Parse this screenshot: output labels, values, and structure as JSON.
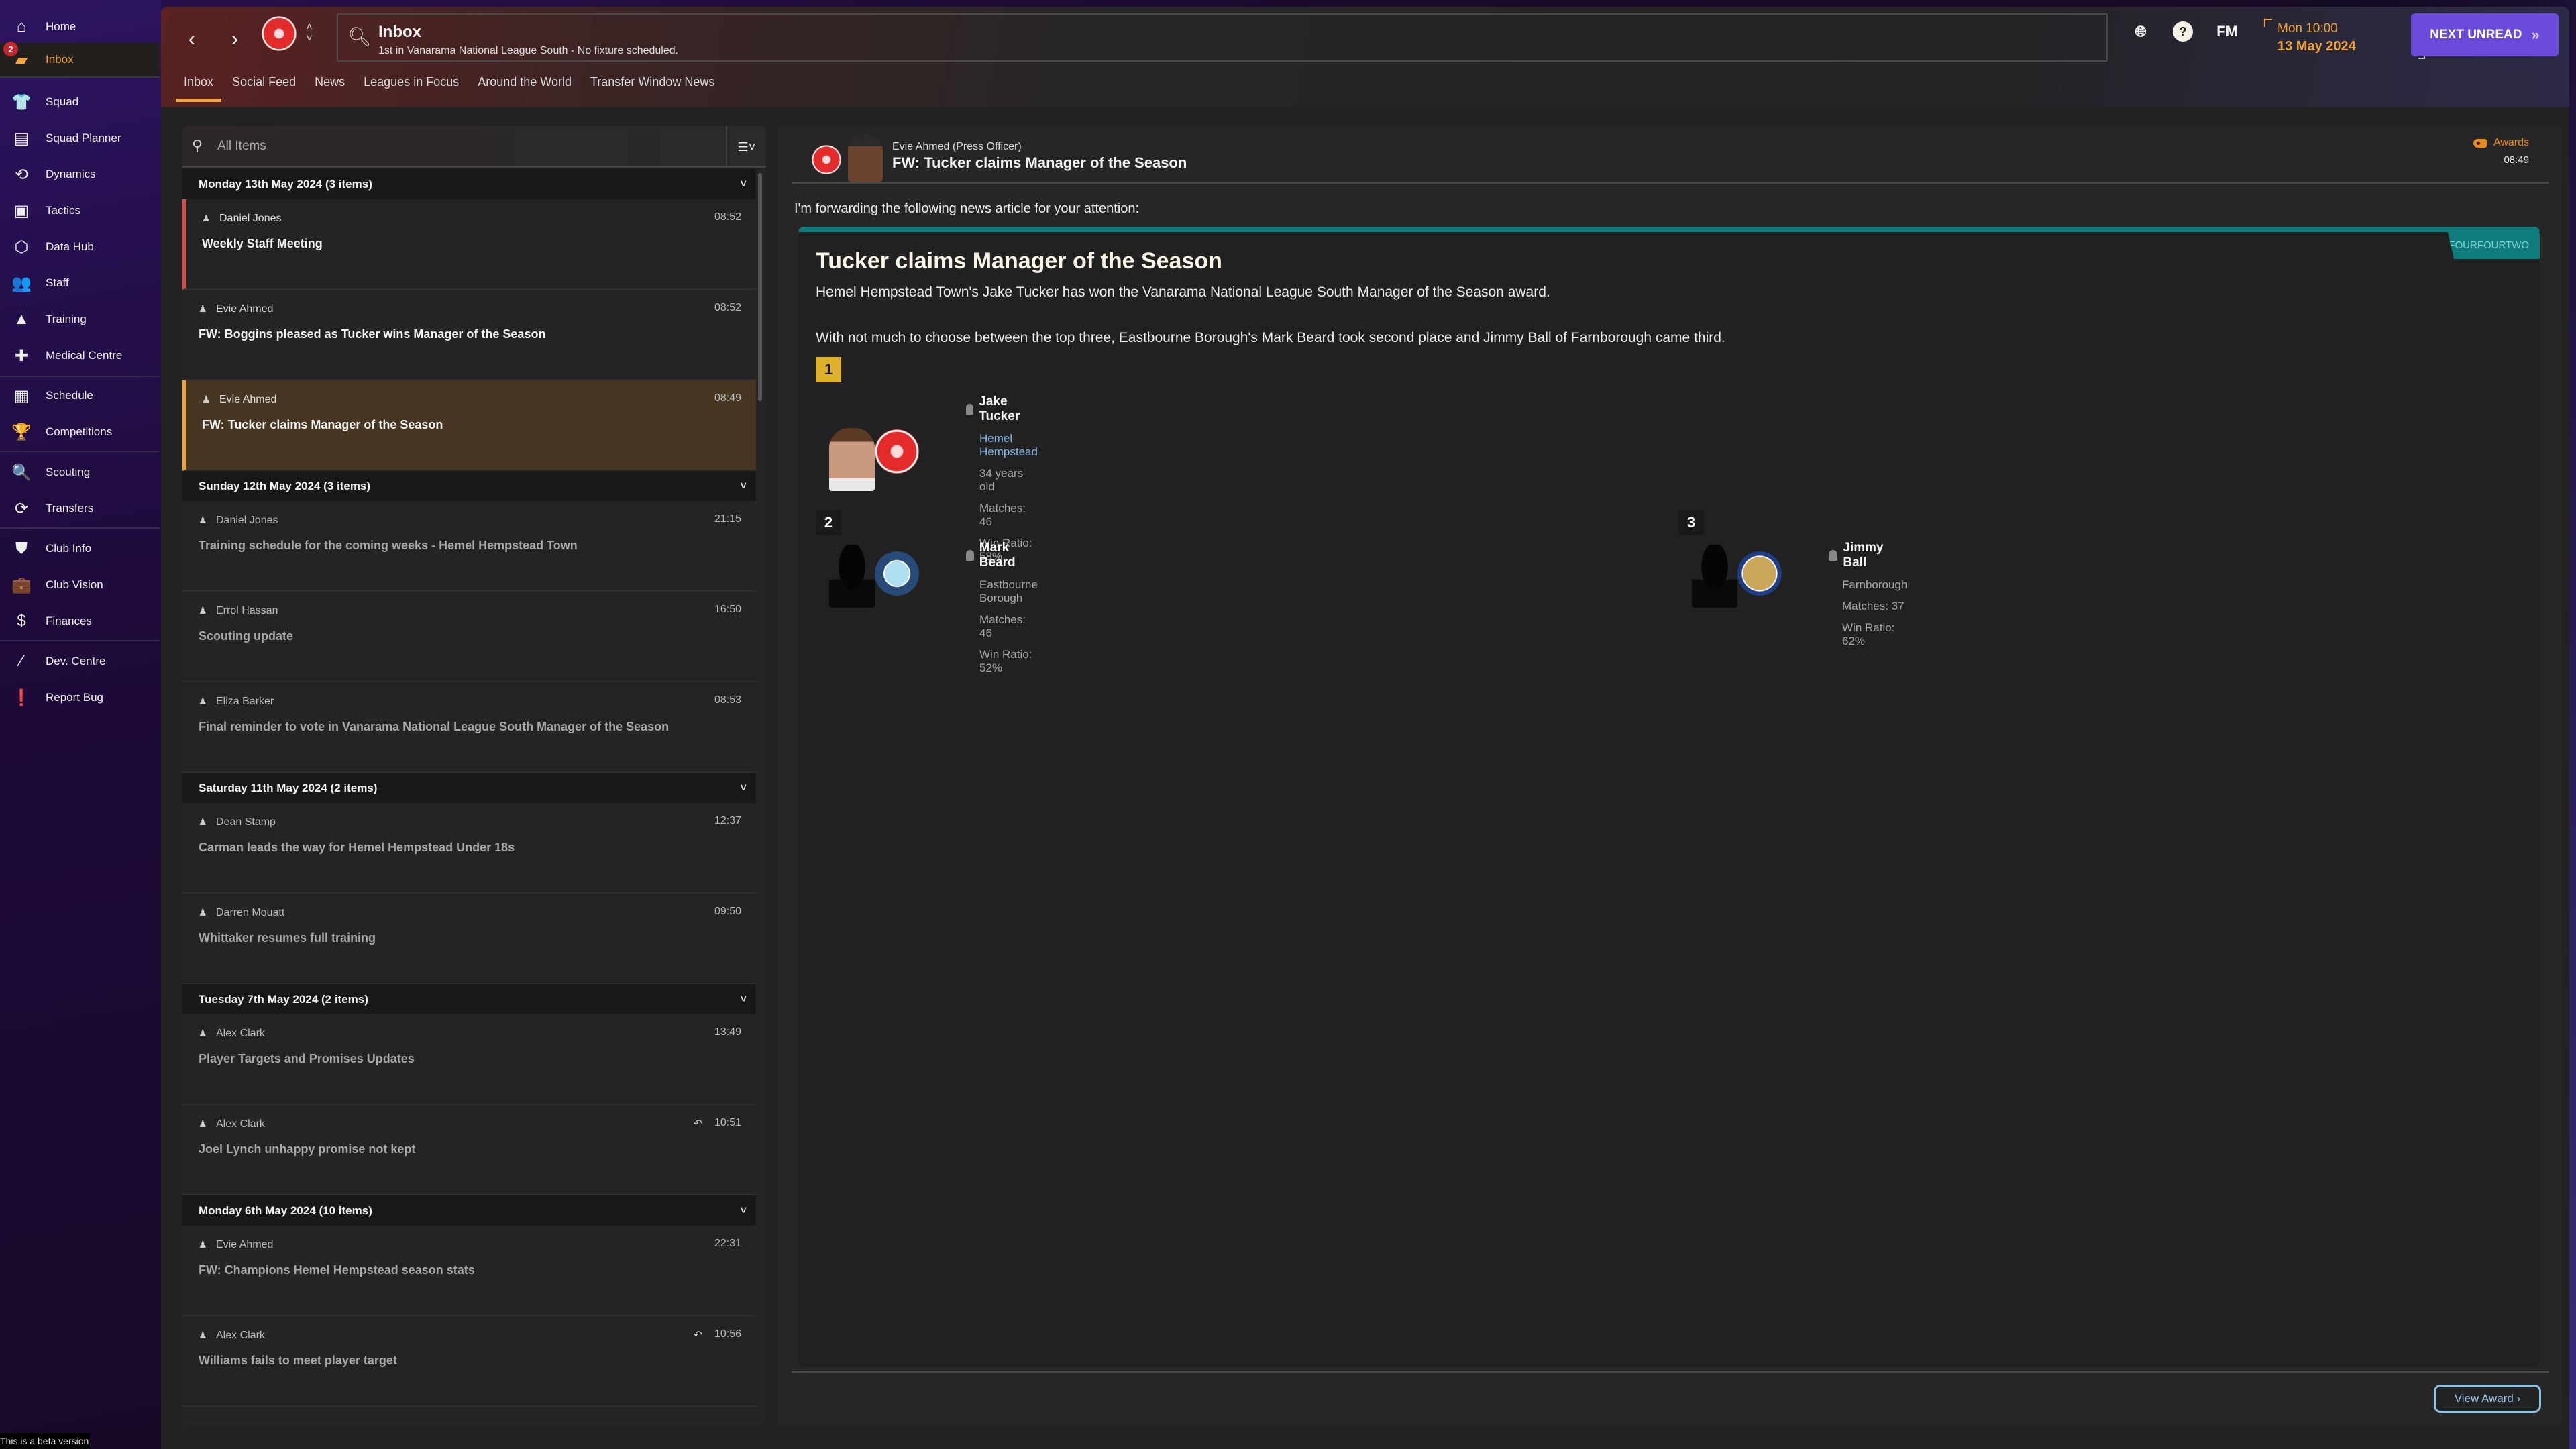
{
  "sidebar": {
    "inbox_badge": "2",
    "items": [
      {
        "label": "Home",
        "icon": "home-icon"
      },
      {
        "label": "Inbox",
        "icon": "inbox-icon",
        "active": true
      },
      {
        "label": "Squad",
        "icon": "shirt-icon"
      },
      {
        "label": "Squad Planner",
        "icon": "clipboard-icon"
      },
      {
        "label": "Dynamics",
        "icon": "dynamics-icon"
      },
      {
        "label": "Tactics",
        "icon": "tactics-icon"
      },
      {
        "label": "Data Hub",
        "icon": "data-hub-icon"
      },
      {
        "label": "Staff",
        "icon": "staff-icon"
      },
      {
        "label": "Training",
        "icon": "training-cone-icon"
      },
      {
        "label": "Medical Centre",
        "icon": "medical-kit-icon"
      },
      {
        "label": "Schedule",
        "icon": "calendar-icon"
      },
      {
        "label": "Competitions",
        "icon": "trophy-icon"
      },
      {
        "label": "Scouting",
        "icon": "search-icon"
      },
      {
        "label": "Transfers",
        "icon": "transfer-arrows-icon"
      },
      {
        "label": "Club Info",
        "icon": "shield-icon"
      },
      {
        "label": "Club Vision",
        "icon": "briefcase-icon"
      },
      {
        "label": "Finances",
        "icon": "money-icon"
      },
      {
        "label": "Dev. Centre",
        "icon": "growth-icon"
      },
      {
        "label": "Report Bug",
        "icon": "alert-icon"
      }
    ],
    "beta_notice": "This is a beta version"
  },
  "header": {
    "title": "Inbox",
    "subtitle": "1st in Vanarama National League South - No fixture scheduled.",
    "tabs": [
      "Inbox",
      "Social Feed",
      "News",
      "Leagues in Focus",
      "Around the World",
      "Transfer Window News"
    ],
    "active_tab": "Inbox",
    "fm_label": "FM",
    "date_time": "Mon 10:00",
    "date_day": "13 May 2024",
    "next_button": "NEXT UNREAD"
  },
  "inbox": {
    "filter_placeholder": "All Items",
    "groups": [
      {
        "title": "Monday 13th May 2024 (3 items)",
        "messages": [
          {
            "from": "Daniel Jones",
            "time": "08:52",
            "subject": "Weekly Staff Meeting",
            "state": "unread"
          },
          {
            "from": "Evie Ahmed",
            "time": "08:52",
            "subject": "FW: Boggins pleased as Tucker wins Manager of the Season",
            "state": "bright"
          },
          {
            "from": "Evie Ahmed",
            "time": "08:49",
            "subject": "FW: Tucker claims Manager of the Season",
            "state": "selected"
          }
        ]
      },
      {
        "title": "Sunday 12th May 2024 (3 items)",
        "messages": [
          {
            "from": "Daniel Jones",
            "time": "21:15",
            "subject": "Training schedule for the coming weeks - Hemel Hempstead Town",
            "state": "read"
          },
          {
            "from": "Errol Hassan",
            "time": "16:50",
            "subject": "Scouting update",
            "state": "read"
          },
          {
            "from": "Eliza Barker",
            "time": "08:53",
            "subject": "Final reminder to vote in Vanarama National League South Manager of the Season",
            "state": "read"
          }
        ]
      },
      {
        "title": "Saturday 11th May 2024 (2 items)",
        "messages": [
          {
            "from": "Dean Stamp",
            "time": "12:37",
            "subject": "Carman leads the way for Hemel Hempstead Under 18s",
            "state": "read"
          },
          {
            "from": "Darren Mouatt",
            "time": "09:50",
            "subject": "Whittaker resumes full training",
            "state": "read"
          }
        ]
      },
      {
        "title": "Tuesday 7th May 2024 (2 items)",
        "messages": [
          {
            "from": "Alex Clark",
            "time": "13:49",
            "subject": "Player Targets and Promises Updates",
            "state": "read"
          },
          {
            "from": "Alex Clark",
            "time": "10:51",
            "subject": "Joel Lynch unhappy promise not kept",
            "state": "read",
            "replied": true
          }
        ]
      },
      {
        "title": "Monday 6th May 2024 (10 items)",
        "messages": [
          {
            "from": "Evie Ahmed",
            "time": "22:31",
            "subject": "FW: Champions Hemel Hempstead season stats",
            "state": "read"
          },
          {
            "from": "Alex Clark",
            "time": "10:56",
            "subject": "Williams fails to meet player target",
            "state": "read",
            "replied": true
          }
        ]
      }
    ]
  },
  "reader": {
    "from": "Evie Ahmed (Press Officer)",
    "subject": "FW: Tucker claims Manager of the Season",
    "category": "Awards",
    "time": "08:49",
    "intro": "I'm forwarding the following news article for your attention:",
    "source": "FOURFOURTWO",
    "article_title": "Tucker claims Manager of the Season",
    "p1": "Hemel Hempstead Town's Jake Tucker has won the Vanarama National League South Manager of the Season award.",
    "p2": "With not much to choose between the top three, Eastbourne Borough's Mark Beard took second place and Jimmy Ball of Farnborough came third.",
    "placings": [
      {
        "rank": "1",
        "name": "Jake Tucker",
        "club": "Hemel Hempstead",
        "age": "34 years old",
        "matches": "Matches: 46",
        "win_ratio": "Win Ratio: 58%"
      },
      {
        "rank": "2",
        "name": "Mark Beard",
        "club": "Eastbourne Borough",
        "matches": "Matches: 46",
        "win_ratio": "Win Ratio: 52%"
      },
      {
        "rank": "3",
        "name": "Jimmy Ball",
        "club": "Farnborough",
        "matches": "Matches: 37",
        "win_ratio": "Win Ratio: 62%"
      }
    ],
    "view_button": "View Award"
  }
}
